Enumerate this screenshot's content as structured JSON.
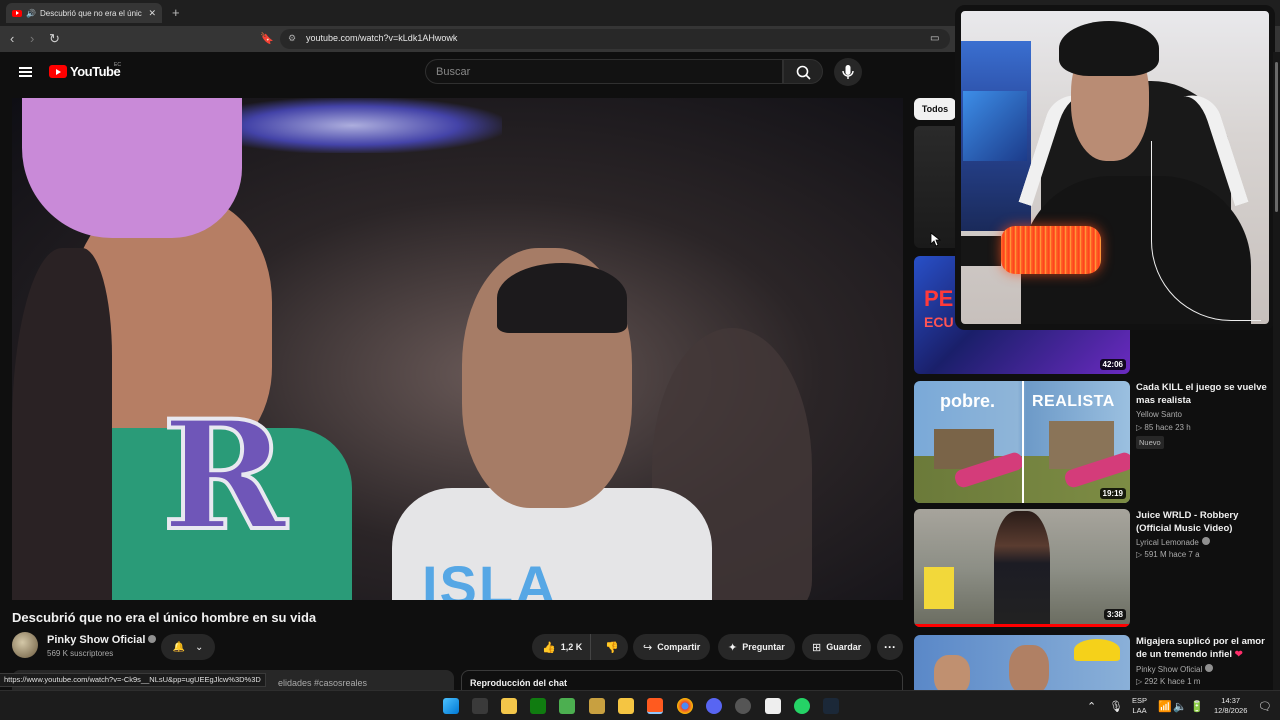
{
  "browser": {
    "tab_title": "Descubrió que no era el únic",
    "tab_close": "✕",
    "new_tab": "+",
    "back": "‹",
    "forward": "›",
    "reload": "↻",
    "url": "youtube.com/watch?v=kLdk1AHwowk",
    "status_url": "https://www.youtube.com/watch?v=-Ck9s__NLsU&pp=ugUEEgJlcw%3D%3D"
  },
  "masthead": {
    "logo_text": "YouTube",
    "country_code": "EC",
    "search_placeholder": "Buscar"
  },
  "video": {
    "title": "Descubrió que no era el único hombre en su vida",
    "channel": "Pinky Show Oficial",
    "subscribers": "569 K suscriptores",
    "frame_text": "ISLA",
    "frame_letter": "R",
    "likes": "1,2 K",
    "share_label": "Compartir",
    "ask_label": "Preguntar",
    "save_label": "Guardar",
    "hashtags": "elidades #casosreales",
    "chat_replay": "Reproducción del chat"
  },
  "sidebar": {
    "chip_all": "Todos",
    "recommendations": [
      {
        "title": "",
        "channel": "",
        "meta": "",
        "duration": ""
      },
      {
        "title": "",
        "channel": "",
        "meta": "",
        "duration": "42:06",
        "thumb_text_1": "PE",
        "thumb_text_2": "ECU"
      },
      {
        "title": "Cada KILL el juego se vuelve mas realista",
        "channel": "Yellow Santo",
        "meta": "▷ 85  hace 23 h",
        "badge": "Nuevo",
        "duration": "19:19",
        "thumb_text_1": "pobre.",
        "thumb_text_2": "REALISTA"
      },
      {
        "title": "Juice WRLD - Robbery (Official Music Video)",
        "channel": "Lyrical Lemonade",
        "meta": "▷ 591 M  hace 7 a",
        "duration": "3:38"
      },
      {
        "title": "Migajera suplicó por el amor de un tremendo infiel",
        "channel": "Pinky Show Oficial",
        "meta": "▷ 292 K  hace 1 m",
        "duration": ""
      }
    ]
  },
  "taskbar": {
    "lang_top": "ESP",
    "lang_bottom": "LAA",
    "time": "14:37",
    "date": "12/8/2026"
  },
  "colors": {
    "background": "#0f0f0f",
    "brand_red": "#ff0000",
    "chip_active": "#f1f1f1"
  }
}
